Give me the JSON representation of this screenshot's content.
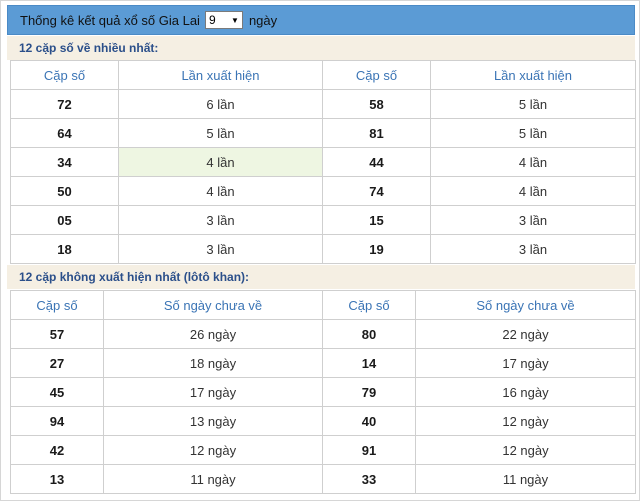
{
  "header": {
    "prefix": "Thống kê kết quả xổ số Gia Lai",
    "days_value": "9",
    "suffix": "ngày"
  },
  "frequent": {
    "title": "12 cặp số về nhiều nhất:",
    "col_pair": "Cặp số",
    "col_count": "Lần xuất hiện",
    "rows": [
      {
        "a": "72",
        "a_count": "6 lần",
        "b": "58",
        "b_count": "5 lần"
      },
      {
        "a": "64",
        "a_count": "5 lần",
        "b": "81",
        "b_count": "5 lần"
      },
      {
        "a": "34",
        "a_count": "4 lần",
        "b": "44",
        "b_count": "4 lần"
      },
      {
        "a": "50",
        "a_count": "4 lần",
        "b": "74",
        "b_count": "4 lần"
      },
      {
        "a": "05",
        "a_count": "3 lần",
        "b": "15",
        "b_count": "3 lần"
      },
      {
        "a": "18",
        "a_count": "3 lần",
        "b": "19",
        "b_count": "3 lần"
      }
    ]
  },
  "absent": {
    "title": "12 cặp không xuất hiện nhất (lôtô khan):",
    "col_pair": "Cặp số",
    "col_days": "Số ngày chưa về",
    "rows": [
      {
        "a": "57",
        "a_days": "26 ngày",
        "b": "80",
        "b_days": "22 ngày"
      },
      {
        "a": "27",
        "a_days": "18 ngày",
        "b": "14",
        "b_days": "17 ngày"
      },
      {
        "a": "45",
        "a_days": "17 ngày",
        "b": "79",
        "b_days": "16 ngày"
      },
      {
        "a": "94",
        "a_days": "13 ngày",
        "b": "40",
        "b_days": "12 ngày"
      },
      {
        "a": "42",
        "a_days": "12 ngày",
        "b": "91",
        "b_days": "12 ngày"
      },
      {
        "a": "13",
        "a_days": "11 ngày",
        "b": "33",
        "b_days": "11 ngày"
      }
    ]
  }
}
